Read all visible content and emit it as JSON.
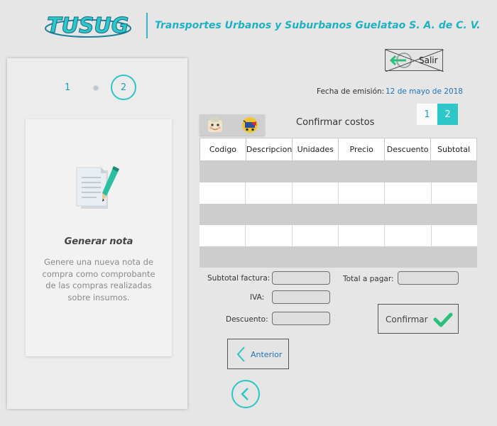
{
  "header": {
    "logo_text": "TUSUG",
    "company_name": "Transportes Urbanos y Suburbanos Guelatao S. A. de C. V."
  },
  "stepper": {
    "step1": "1",
    "step2": "2"
  },
  "card": {
    "title": "Generar nota",
    "description": "Genere una nueva nota de compra como comprobante de las compras realizadas sobre insumos."
  },
  "toolbar": {
    "exit_label": "Salir"
  },
  "emission": {
    "label": "Fecha de emisión:",
    "date": "12 de mayo de 2018"
  },
  "pagination": {
    "page1": "1",
    "page2": "2",
    "active": "2"
  },
  "section_title": "Confirmar costos",
  "table": {
    "columns": [
      "Codigo",
      "Descripcion",
      "Unidades",
      "Precio",
      "Descuento",
      "Subtotal"
    ]
  },
  "form": {
    "subtotal_label": "Subtotal factura:",
    "iva_label": "IVA:",
    "descuento_label": "Descuento:",
    "total_label": "Total a pagar:",
    "subtotal_value": "",
    "iva_value": "",
    "descuento_value": "",
    "total_value": ""
  },
  "buttons": {
    "confirm_label": "Confirmar",
    "previous_label": "Anterior"
  },
  "colors": {
    "accent": "#2ec7c9",
    "brand": "#1fb1c1",
    "link": "#1a72b8",
    "check": "#2bbf7a"
  },
  "icons": {
    "logo": "tusug-logo",
    "exit": "exit-arrow-icon",
    "note": "document-pen-icon",
    "toolbar1": "supplier-face-icon",
    "toolbar2": "shopping-cart-icon",
    "confirm": "checkmark-icon",
    "previous": "chevron-left-icon",
    "back": "back-circle-icon"
  }
}
